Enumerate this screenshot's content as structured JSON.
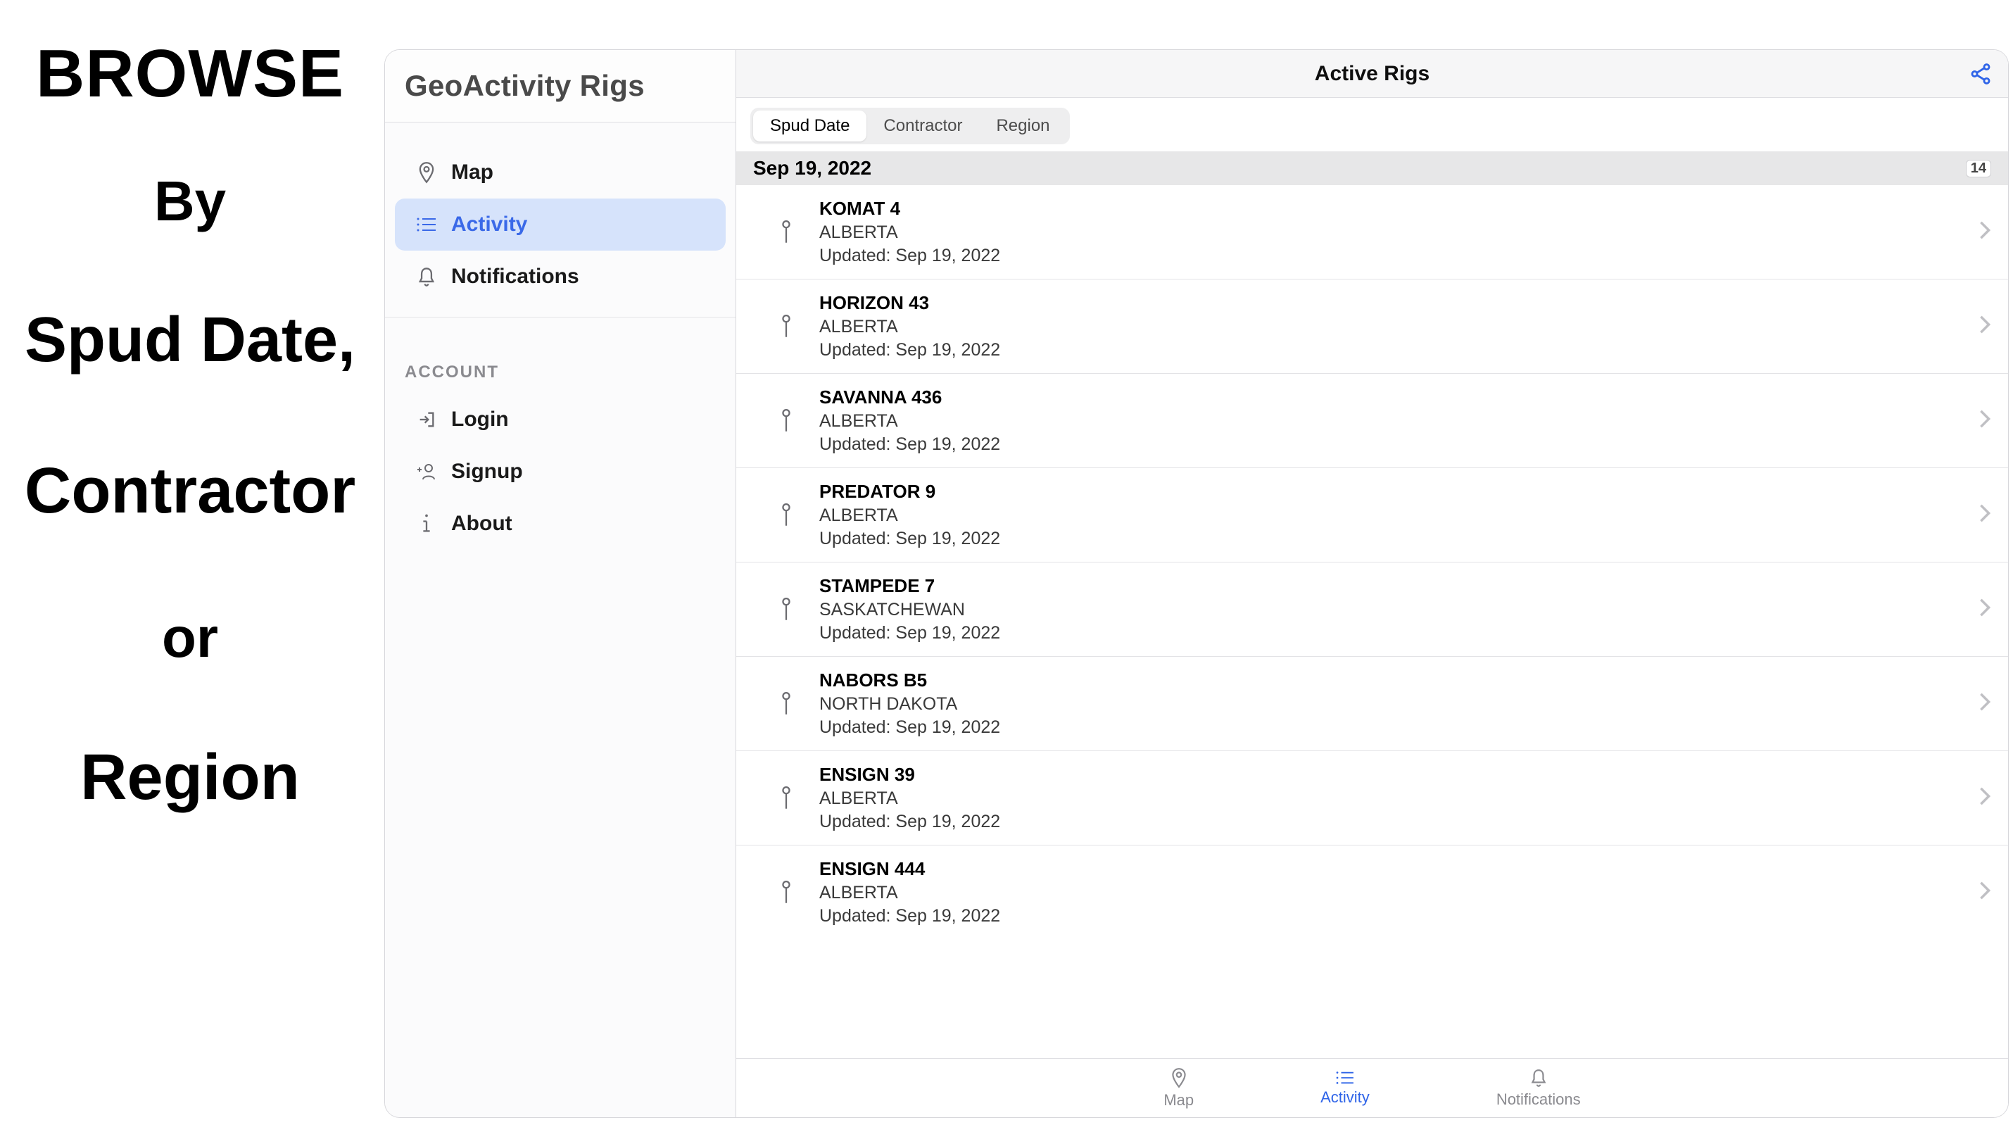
{
  "promo": {
    "line1": "BROWSE",
    "line2": "By",
    "line3": "Spud Date,",
    "line4": "Contractor",
    "line5": "or",
    "line6": "Region"
  },
  "sidebar": {
    "title": "GeoActivity Rigs",
    "nav": [
      {
        "label": "Map"
      },
      {
        "label": "Activity"
      },
      {
        "label": "Notifications"
      }
    ],
    "account_label": "ACCOUNT",
    "account": [
      {
        "label": "Login"
      },
      {
        "label": "Signup"
      },
      {
        "label": "About"
      }
    ]
  },
  "main": {
    "title": "Active Rigs",
    "segments": [
      {
        "label": "Spud Date"
      },
      {
        "label": "Contractor"
      },
      {
        "label": "Region"
      }
    ],
    "section": {
      "date": "Sep 19, 2022",
      "count": "14"
    },
    "rows": [
      {
        "name": "KOMAT 4",
        "region": "ALBERTA",
        "updated": "Updated: Sep 19, 2022"
      },
      {
        "name": "HORIZON 43",
        "region": "ALBERTA",
        "updated": "Updated: Sep 19, 2022"
      },
      {
        "name": "SAVANNA 436",
        "region": "ALBERTA",
        "updated": "Updated: Sep 19, 2022"
      },
      {
        "name": "PREDATOR 9",
        "region": "ALBERTA",
        "updated": "Updated: Sep 19, 2022"
      },
      {
        "name": "STAMPEDE 7",
        "region": "SASKATCHEWAN",
        "updated": "Updated: Sep 19, 2022"
      },
      {
        "name": "NABORS B5",
        "region": "NORTH DAKOTA",
        "updated": "Updated: Sep 19, 2022"
      },
      {
        "name": "ENSIGN 39",
        "region": "ALBERTA",
        "updated": "Updated: Sep 19, 2022"
      },
      {
        "name": "ENSIGN 444",
        "region": "ALBERTA",
        "updated": "Updated: Sep 19, 2022"
      }
    ],
    "tabs": [
      {
        "label": "Map"
      },
      {
        "label": "Activity"
      },
      {
        "label": "Notifications"
      }
    ]
  }
}
